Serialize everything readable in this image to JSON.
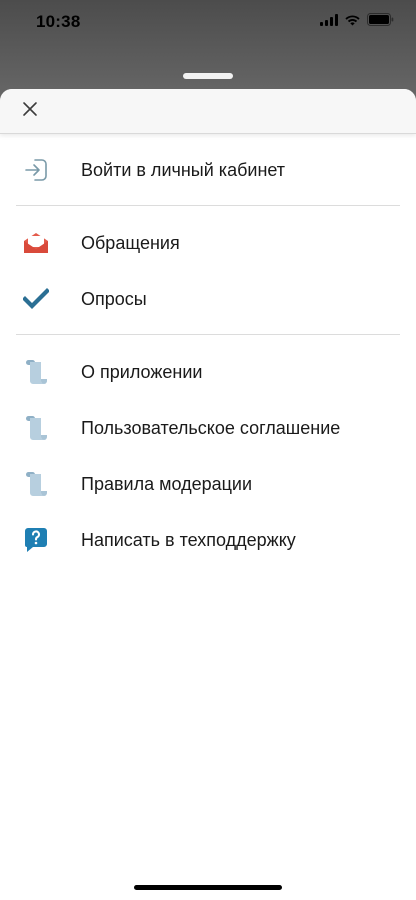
{
  "status_bar": {
    "time": "10:38",
    "icons": [
      "signal-icon",
      "wifi-icon",
      "battery-icon"
    ]
  },
  "sheet": {
    "close_icon": "close-icon",
    "sections": [
      {
        "items": [
          {
            "label": "Войти в личный кабинет",
            "icon": "login-icon"
          }
        ]
      },
      {
        "items": [
          {
            "label": "Обращения",
            "icon": "envelope-icon"
          },
          {
            "label": "Опросы",
            "icon": "checkmark-icon"
          }
        ]
      },
      {
        "items": [
          {
            "label": "О приложении",
            "icon": "scroll-icon"
          },
          {
            "label": "Пользовательское соглашение",
            "icon": "scroll-icon"
          },
          {
            "label": "Правила модерации",
            "icon": "scroll-icon"
          },
          {
            "label": "Написать в техподдержку",
            "icon": "support-chat-icon"
          }
        ]
      }
    ]
  },
  "colors": {
    "login_icon": "#7a9aa8",
    "envelope": "#e45b4b",
    "checkmark": "#2b6f94",
    "scroll": "#a9c4d6",
    "support": "#1f7fb3"
  }
}
